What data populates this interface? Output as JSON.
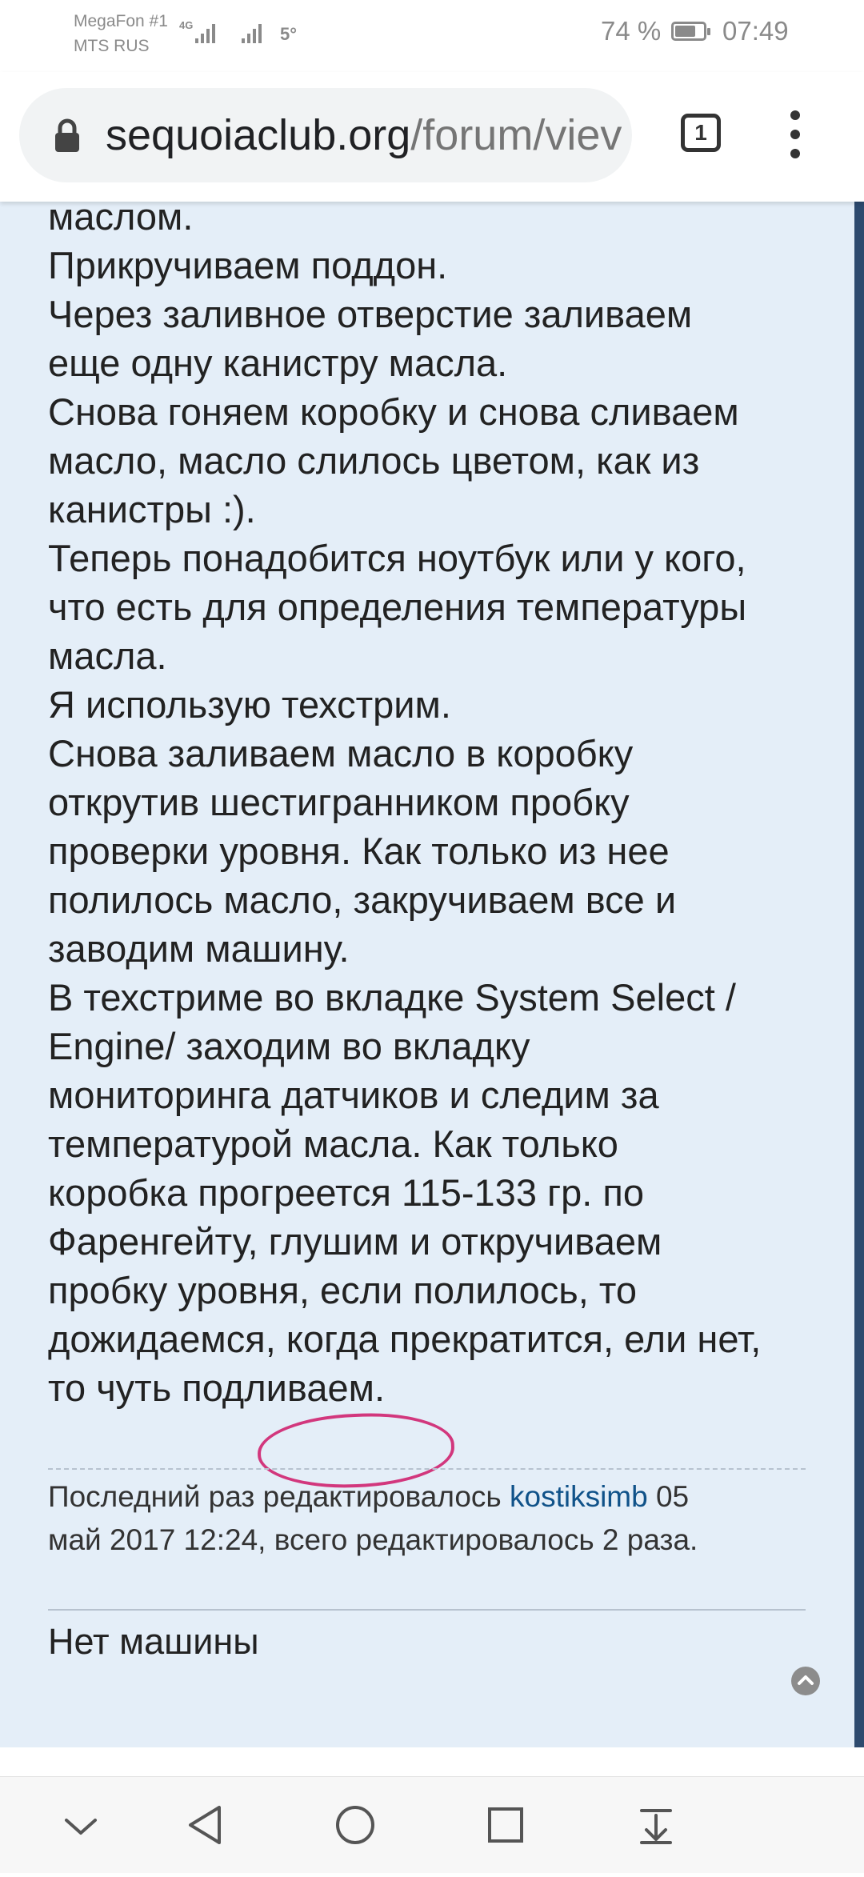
{
  "status_bar": {
    "carrier_1": "MegaFon #1",
    "carrier_2": "MTS RUS",
    "network_type": "4G",
    "temperature": "5°",
    "battery_percent": "74 %",
    "battery_level": 0.74,
    "time": "07:49"
  },
  "browser": {
    "url_domain": "sequoiaclub.org",
    "url_path": "/forum/viev",
    "tab_count": "1",
    "icons": [
      "lock-icon",
      "tab-switcher-icon",
      "overflow-menu-icon"
    ]
  },
  "post": {
    "lines": [
      "маслом.",
      "Прикручиваем поддон.",
      "Через заливное отверстие заливаем",
      "еще одну канистру масла.",
      "Снова гоняем коробку и снова сливаем",
      "масло, масло слилось цветом, как из",
      "канистры :).",
      "Теперь понадобится ноутбук или у кого,",
      "что есть для определения температуры",
      "масла.",
      "Я использую техстрим.",
      "Снова заливаем масло в коробку",
      "открутив шестигранником пробку",
      "проверки уровня. Как только из нее",
      "полилось масло, закручиваем все и",
      "заводим машину.",
      "В техстриме во вкладке System Select /",
      "Engine/ заходим во вкладку",
      "мониторинга датчиков и следим за",
      "температурой масла. Как только",
      "коробка прогреется 115-133 гр. по",
      "Фаренгейту, глушим и откручиваем",
      "пробку уровня, если полилось, то",
      "дожидаемся, когда прекратится, ели нет,",
      "то чуть подливаем."
    ],
    "highlight_color": "#d2377d",
    "edit_note": {
      "prefix": "Последний раз редактировалось",
      "username": "kostiksimb",
      "date_part": "05",
      "line2": "май 2017 12:24, всего редактировалось 2 раза."
    },
    "signature": "Нет машины"
  },
  "nav_bar": {
    "icons": [
      "chevron-down-icon",
      "back-icon",
      "home-icon",
      "recents-icon",
      "download-icon"
    ]
  },
  "colors": {
    "post_background": "#e4eef8",
    "link": "#105289",
    "scrollbar": "#2d4a6e"
  }
}
